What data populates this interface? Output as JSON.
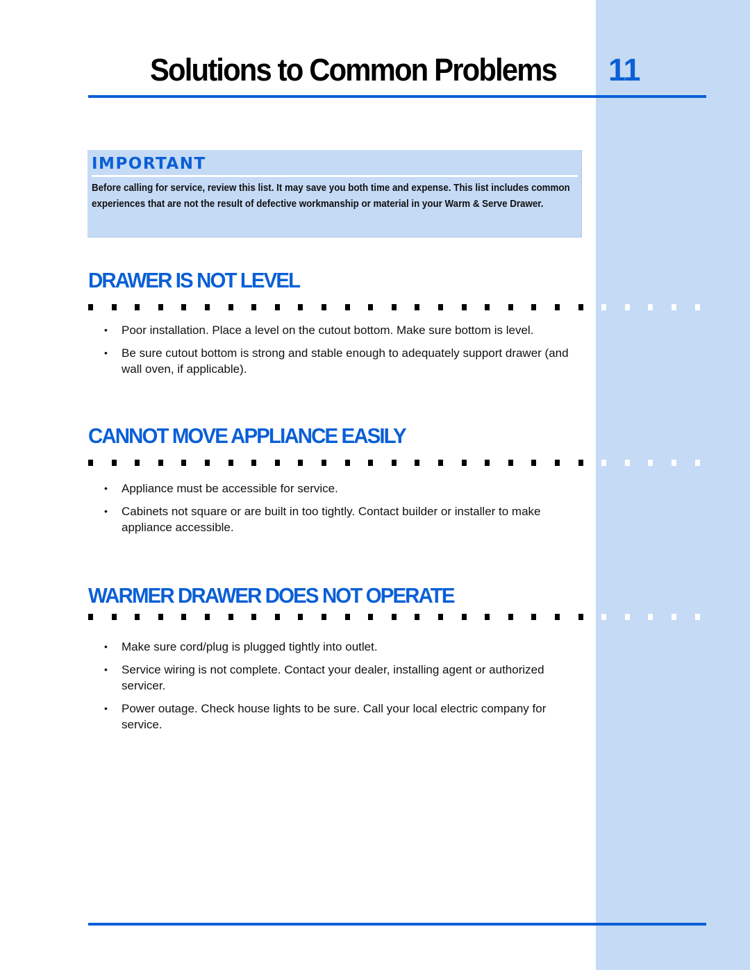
{
  "page": {
    "title": "Solutions to Common Problems",
    "number": "11"
  },
  "important": {
    "label": "IMPORTANT",
    "text": "Before calling for service, review this list. It may save you both time and expense. This list includes common experiences that are not the result of defective workmanship or material in your Warm & Serve Drawer."
  },
  "sections": [
    {
      "heading": "DRAWER IS NOT LEVEL",
      "items": [
        "Poor installation. Place a level on the cutout bottom. Make sure bottom is level.",
        "Be sure cutout bottom is strong and stable enough to adequately support drawer (and wall oven, if applicable)."
      ]
    },
    {
      "heading": "CANNOT MOVE APPLIANCE EASILY",
      "items": [
        "Appliance must be accessible for service.",
        "Cabinets not square or are built in too tightly. Contact builder or installer to make appliance accessible."
      ]
    },
    {
      "heading": "WARMER DRAWER DOES NOT OPERATE",
      "items": [
        "Make sure cord/plug is plugged tightly into outlet.",
        "Service wiring is not complete. Contact your dealer, installing agent or authorized servicer.",
        "Power outage. Check house lights to be sure. Call your local electric company for service."
      ]
    }
  ],
  "bullet_glyph": "•",
  "colors": {
    "accent": "#0a5fd6",
    "sidebar": "#c5daf5",
    "text": "#111111"
  }
}
